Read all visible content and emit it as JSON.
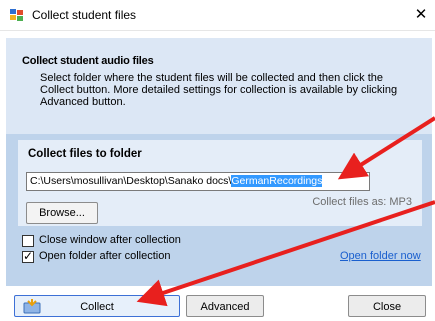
{
  "window": {
    "title": "Collect student files",
    "close_glyph": "✕",
    "icon": "app-icon"
  },
  "header": {
    "title": "Collect student audio files",
    "description": "Select folder where the student files will be collected and then click the Collect button. More detailed settings for collection is available by clicking Advanced button."
  },
  "folder": {
    "label": "Collect files to folder",
    "path_prefix": "C:\\Users\\mosullivan\\Desktop\\Sanako docs\\",
    "path_selected": "GermanRecordings",
    "browse_label": "Browse...",
    "collect_as": "Collect files as: MP3"
  },
  "options": {
    "close_window": {
      "label": "Close window after collection",
      "checked": false
    },
    "open_folder": {
      "label": "Open folder after collection",
      "checked": true
    },
    "open_folder_link": "Open folder now"
  },
  "buttons": {
    "collect": "Collect",
    "advanced": "Advanced",
    "close": "Close"
  },
  "colors": {
    "annotation_arrow": "#e8201e",
    "panel_blue": "#bed3eb",
    "selection": "#3399ff",
    "link": "#1a5fce"
  }
}
